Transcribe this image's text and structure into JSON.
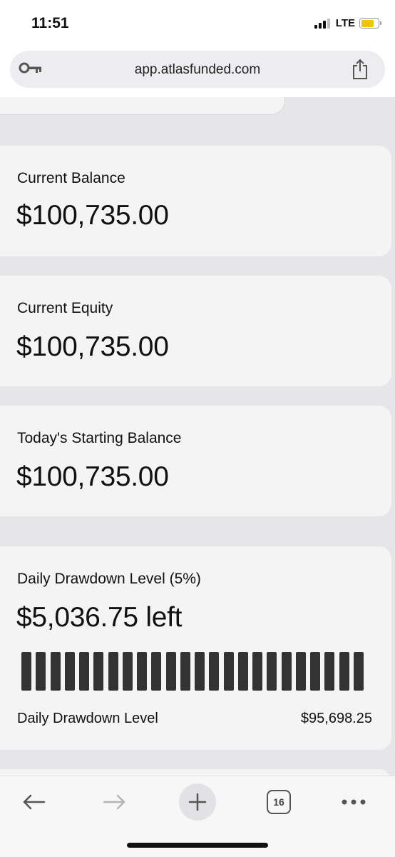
{
  "status_bar": {
    "time": "11:51",
    "network": "LTE",
    "signal_bars_active": 3,
    "signal_bars_total": 4,
    "battery_color": "#f2c400"
  },
  "browser": {
    "url": "app.atlasfunded.com",
    "left_icon": "key-icon",
    "right_icon": "share-icon"
  },
  "cards": [
    {
      "label": "Current Balance",
      "value": "$100,735.00"
    },
    {
      "label": "Current Equity",
      "value": "$100,735.00"
    },
    {
      "label": "Today's Starting Balance",
      "value": "$100,735.00"
    }
  ],
  "drawdown": {
    "label": "Daily Drawdown Level (5%)",
    "value": "$5,036.75 left",
    "bar_count": 24,
    "bar_color": "#333333",
    "footer_label": "Daily Drawdown Level",
    "footer_value": "$95,698.25"
  },
  "toolbar": {
    "items": [
      "back-arrow-icon",
      "forward-arrow-icon",
      "new-tab-plus-icon",
      "tabs-icon",
      "more-icon"
    ],
    "tab_count": "16"
  }
}
